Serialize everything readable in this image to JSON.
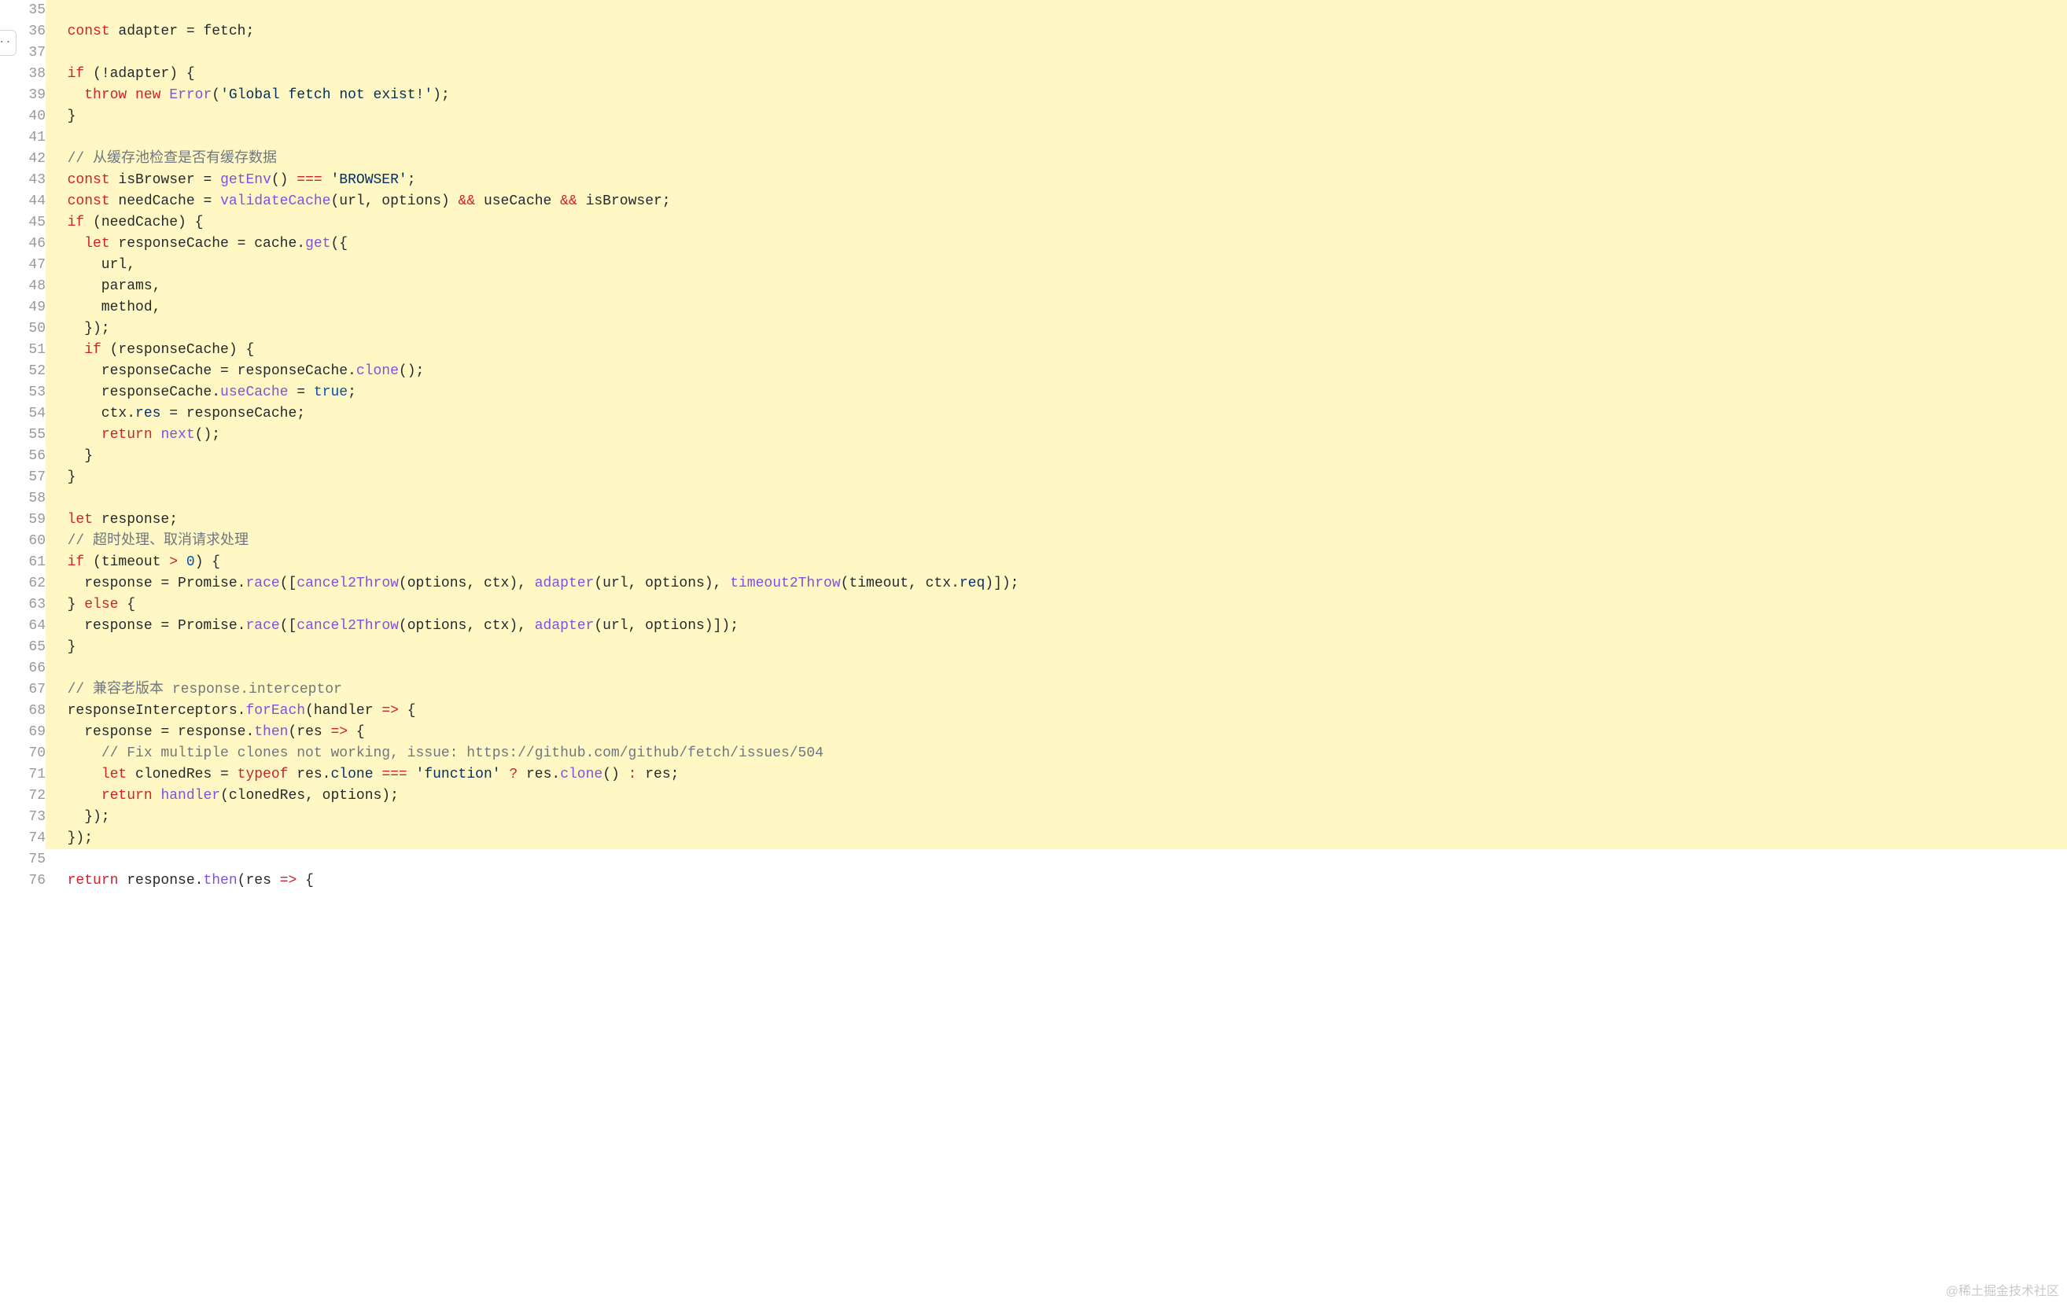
{
  "watermark": "@稀土掘金技术社区",
  "expander_glyph": "··",
  "lines": [
    {
      "n": 35,
      "hl": true,
      "tokens": []
    },
    {
      "n": 36,
      "hl": true,
      "tokens": [
        {
          "t": "  ",
          "c": ""
        },
        {
          "t": "const",
          "c": "kw"
        },
        {
          "t": " adapter = fetch;",
          "c": ""
        }
      ]
    },
    {
      "n": 37,
      "hl": true,
      "tokens": []
    },
    {
      "n": 38,
      "hl": true,
      "tokens": [
        {
          "t": "  ",
          "c": ""
        },
        {
          "t": "if",
          "c": "kw"
        },
        {
          "t": " (!adapter) {",
          "c": ""
        }
      ]
    },
    {
      "n": 39,
      "hl": true,
      "tokens": [
        {
          "t": "    ",
          "c": ""
        },
        {
          "t": "throw",
          "c": "kw"
        },
        {
          "t": " ",
          "c": ""
        },
        {
          "t": "new",
          "c": "kw"
        },
        {
          "t": " ",
          "c": ""
        },
        {
          "t": "Error",
          "c": "fn"
        },
        {
          "t": "(",
          "c": ""
        },
        {
          "t": "'Global fetch not exist!'",
          "c": "str"
        },
        {
          "t": ");",
          "c": ""
        }
      ]
    },
    {
      "n": 40,
      "hl": true,
      "tokens": [
        {
          "t": "  }",
          "c": ""
        }
      ]
    },
    {
      "n": 41,
      "hl": true,
      "tokens": []
    },
    {
      "n": 42,
      "hl": true,
      "tokens": [
        {
          "t": "  ",
          "c": ""
        },
        {
          "t": "// 从缓存池检查是否有缓存数据",
          "c": "cmt"
        }
      ]
    },
    {
      "n": 43,
      "hl": true,
      "tokens": [
        {
          "t": "  ",
          "c": ""
        },
        {
          "t": "const",
          "c": "kw"
        },
        {
          "t": " isBrowser = ",
          "c": ""
        },
        {
          "t": "getEnv",
          "c": "fn"
        },
        {
          "t": "() ",
          "c": ""
        },
        {
          "t": "===",
          "c": "op"
        },
        {
          "t": " ",
          "c": ""
        },
        {
          "t": "'BROWSER'",
          "c": "str"
        },
        {
          "t": ";",
          "c": ""
        }
      ]
    },
    {
      "n": 44,
      "hl": true,
      "tokens": [
        {
          "t": "  ",
          "c": ""
        },
        {
          "t": "const",
          "c": "kw"
        },
        {
          "t": " needCache = ",
          "c": ""
        },
        {
          "t": "validateCache",
          "c": "fn"
        },
        {
          "t": "(url, options) ",
          "c": ""
        },
        {
          "t": "&&",
          "c": "op"
        },
        {
          "t": " useCache ",
          "c": ""
        },
        {
          "t": "&&",
          "c": "op"
        },
        {
          "t": " isBrowser;",
          "c": ""
        }
      ]
    },
    {
      "n": 45,
      "hl": true,
      "tokens": [
        {
          "t": "  ",
          "c": ""
        },
        {
          "t": "if",
          "c": "kw"
        },
        {
          "t": " (needCache) {",
          "c": ""
        }
      ]
    },
    {
      "n": 46,
      "hl": true,
      "tokens": [
        {
          "t": "    ",
          "c": ""
        },
        {
          "t": "let",
          "c": "kw"
        },
        {
          "t": " responseCache = cache.",
          "c": ""
        },
        {
          "t": "get",
          "c": "fn"
        },
        {
          "t": "({",
          "c": ""
        }
      ]
    },
    {
      "n": 47,
      "hl": true,
      "tokens": [
        {
          "t": "      url,",
          "c": ""
        }
      ]
    },
    {
      "n": 48,
      "hl": true,
      "tokens": [
        {
          "t": "      params,",
          "c": ""
        }
      ]
    },
    {
      "n": 49,
      "hl": true,
      "tokens": [
        {
          "t": "      method,",
          "c": ""
        }
      ]
    },
    {
      "n": 50,
      "hl": true,
      "tokens": [
        {
          "t": "    });",
          "c": ""
        }
      ]
    },
    {
      "n": 51,
      "hl": true,
      "tokens": [
        {
          "t": "    ",
          "c": ""
        },
        {
          "t": "if",
          "c": "kw"
        },
        {
          "t": " (responseCache) {",
          "c": ""
        }
      ]
    },
    {
      "n": 52,
      "hl": true,
      "tokens": [
        {
          "t": "      responseCache = responseCache.",
          "c": ""
        },
        {
          "t": "clone",
          "c": "fn"
        },
        {
          "t": "();",
          "c": ""
        }
      ]
    },
    {
      "n": 53,
      "hl": true,
      "tokens": [
        {
          "t": "      responseCache.",
          "c": ""
        },
        {
          "t": "useCache",
          "c": "fn"
        },
        {
          "t": " = ",
          "c": ""
        },
        {
          "t": "true",
          "c": "bool"
        },
        {
          "t": ";",
          "c": ""
        }
      ]
    },
    {
      "n": 54,
      "hl": true,
      "tokens": [
        {
          "t": "      ctx.",
          "c": ""
        },
        {
          "t": "res",
          "c": "prop"
        },
        {
          "t": " = responseCache;",
          "c": ""
        }
      ]
    },
    {
      "n": 55,
      "hl": true,
      "tokens": [
        {
          "t": "      ",
          "c": ""
        },
        {
          "t": "return",
          "c": "kw"
        },
        {
          "t": " ",
          "c": ""
        },
        {
          "t": "next",
          "c": "fn"
        },
        {
          "t": "();",
          "c": ""
        }
      ]
    },
    {
      "n": 56,
      "hl": true,
      "tokens": [
        {
          "t": "    }",
          "c": ""
        }
      ]
    },
    {
      "n": 57,
      "hl": true,
      "tokens": [
        {
          "t": "  }",
          "c": ""
        }
      ]
    },
    {
      "n": 58,
      "hl": true,
      "tokens": []
    },
    {
      "n": 59,
      "hl": true,
      "tokens": [
        {
          "t": "  ",
          "c": ""
        },
        {
          "t": "let",
          "c": "kw"
        },
        {
          "t": " response;",
          "c": ""
        }
      ]
    },
    {
      "n": 60,
      "hl": true,
      "tokens": [
        {
          "t": "  ",
          "c": ""
        },
        {
          "t": "// 超时处理、取消请求处理",
          "c": "cmt"
        }
      ]
    },
    {
      "n": 61,
      "hl": true,
      "tokens": [
        {
          "t": "  ",
          "c": ""
        },
        {
          "t": "if",
          "c": "kw"
        },
        {
          "t": " (timeout ",
          "c": ""
        },
        {
          "t": ">",
          "c": "op"
        },
        {
          "t": " ",
          "c": ""
        },
        {
          "t": "0",
          "c": "num"
        },
        {
          "t": ") {",
          "c": ""
        }
      ]
    },
    {
      "n": 62,
      "hl": true,
      "tokens": [
        {
          "t": "    response = ",
          "c": ""
        },
        {
          "t": "Promise",
          "c": ""
        },
        {
          "t": ".",
          "c": ""
        },
        {
          "t": "race",
          "c": "fn"
        },
        {
          "t": "([",
          "c": ""
        },
        {
          "t": "cancel2Throw",
          "c": "fn"
        },
        {
          "t": "(options, ctx), ",
          "c": ""
        },
        {
          "t": "adapter",
          "c": "fn"
        },
        {
          "t": "(url, options), ",
          "c": ""
        },
        {
          "t": "timeout2Throw",
          "c": "fn"
        },
        {
          "t": "(timeout, ctx.",
          "c": ""
        },
        {
          "t": "req",
          "c": "prop"
        },
        {
          "t": ")]);",
          "c": ""
        }
      ]
    },
    {
      "n": 63,
      "hl": true,
      "tokens": [
        {
          "t": "  } ",
          "c": ""
        },
        {
          "t": "else",
          "c": "kw"
        },
        {
          "t": " {",
          "c": ""
        }
      ]
    },
    {
      "n": 64,
      "hl": true,
      "tokens": [
        {
          "t": "    response = ",
          "c": ""
        },
        {
          "t": "Promise",
          "c": ""
        },
        {
          "t": ".",
          "c": ""
        },
        {
          "t": "race",
          "c": "fn"
        },
        {
          "t": "([",
          "c": ""
        },
        {
          "t": "cancel2Throw",
          "c": "fn"
        },
        {
          "t": "(options, ctx), ",
          "c": ""
        },
        {
          "t": "adapter",
          "c": "fn"
        },
        {
          "t": "(url, options)]);",
          "c": ""
        }
      ]
    },
    {
      "n": 65,
      "hl": true,
      "tokens": [
        {
          "t": "  }",
          "c": ""
        }
      ]
    },
    {
      "n": 66,
      "hl": true,
      "tokens": []
    },
    {
      "n": 67,
      "hl": true,
      "tokens": [
        {
          "t": "  ",
          "c": ""
        },
        {
          "t": "// 兼容老版本 response.interceptor",
          "c": "cmt"
        }
      ]
    },
    {
      "n": 68,
      "hl": true,
      "tokens": [
        {
          "t": "  responseInterceptors.",
          "c": ""
        },
        {
          "t": "forEach",
          "c": "fn"
        },
        {
          "t": "(",
          "c": ""
        },
        {
          "t": "handler",
          "c": ""
        },
        {
          "t": " ",
          "c": ""
        },
        {
          "t": "=>",
          "c": "op"
        },
        {
          "t": " {",
          "c": ""
        }
      ]
    },
    {
      "n": 69,
      "hl": true,
      "tokens": [
        {
          "t": "    response = response.",
          "c": ""
        },
        {
          "t": "then",
          "c": "fn"
        },
        {
          "t": "(",
          "c": ""
        },
        {
          "t": "res",
          "c": ""
        },
        {
          "t": " ",
          "c": ""
        },
        {
          "t": "=>",
          "c": "op"
        },
        {
          "t": " {",
          "c": ""
        }
      ]
    },
    {
      "n": 70,
      "hl": true,
      "tokens": [
        {
          "t": "      ",
          "c": ""
        },
        {
          "t": "// Fix multiple clones not working, issue: https://github.com/github/fetch/issues/504",
          "c": "cmt"
        }
      ]
    },
    {
      "n": 71,
      "hl": true,
      "tokens": [
        {
          "t": "      ",
          "c": ""
        },
        {
          "t": "let",
          "c": "kw"
        },
        {
          "t": " clonedRes = ",
          "c": ""
        },
        {
          "t": "typeof",
          "c": "kw"
        },
        {
          "t": " res.",
          "c": ""
        },
        {
          "t": "clone",
          "c": "prop"
        },
        {
          "t": " ",
          "c": ""
        },
        {
          "t": "===",
          "c": "op"
        },
        {
          "t": " ",
          "c": ""
        },
        {
          "t": "'function'",
          "c": "str"
        },
        {
          "t": " ",
          "c": ""
        },
        {
          "t": "?",
          "c": "op"
        },
        {
          "t": " res.",
          "c": ""
        },
        {
          "t": "clone",
          "c": "fn"
        },
        {
          "t": "() ",
          "c": ""
        },
        {
          "t": ":",
          "c": "op"
        },
        {
          "t": " res;",
          "c": ""
        }
      ]
    },
    {
      "n": 72,
      "hl": true,
      "tokens": [
        {
          "t": "      ",
          "c": ""
        },
        {
          "t": "return",
          "c": "kw"
        },
        {
          "t": " ",
          "c": ""
        },
        {
          "t": "handler",
          "c": "fn"
        },
        {
          "t": "(clonedRes, options);",
          "c": ""
        }
      ]
    },
    {
      "n": 73,
      "hl": true,
      "tokens": [
        {
          "t": "    });",
          "c": ""
        }
      ]
    },
    {
      "n": 74,
      "hl": true,
      "tokens": [
        {
          "t": "  });",
          "c": ""
        }
      ]
    },
    {
      "n": 75,
      "hl": false,
      "tokens": []
    },
    {
      "n": 76,
      "hl": false,
      "tokens": [
        {
          "t": "  ",
          "c": ""
        },
        {
          "t": "return",
          "c": "kw"
        },
        {
          "t": " response.",
          "c": ""
        },
        {
          "t": "then",
          "c": "fn"
        },
        {
          "t": "(",
          "c": ""
        },
        {
          "t": "res",
          "c": ""
        },
        {
          "t": " ",
          "c": ""
        },
        {
          "t": "=>",
          "c": "op"
        },
        {
          "t": " {",
          "c": ""
        }
      ]
    }
  ]
}
